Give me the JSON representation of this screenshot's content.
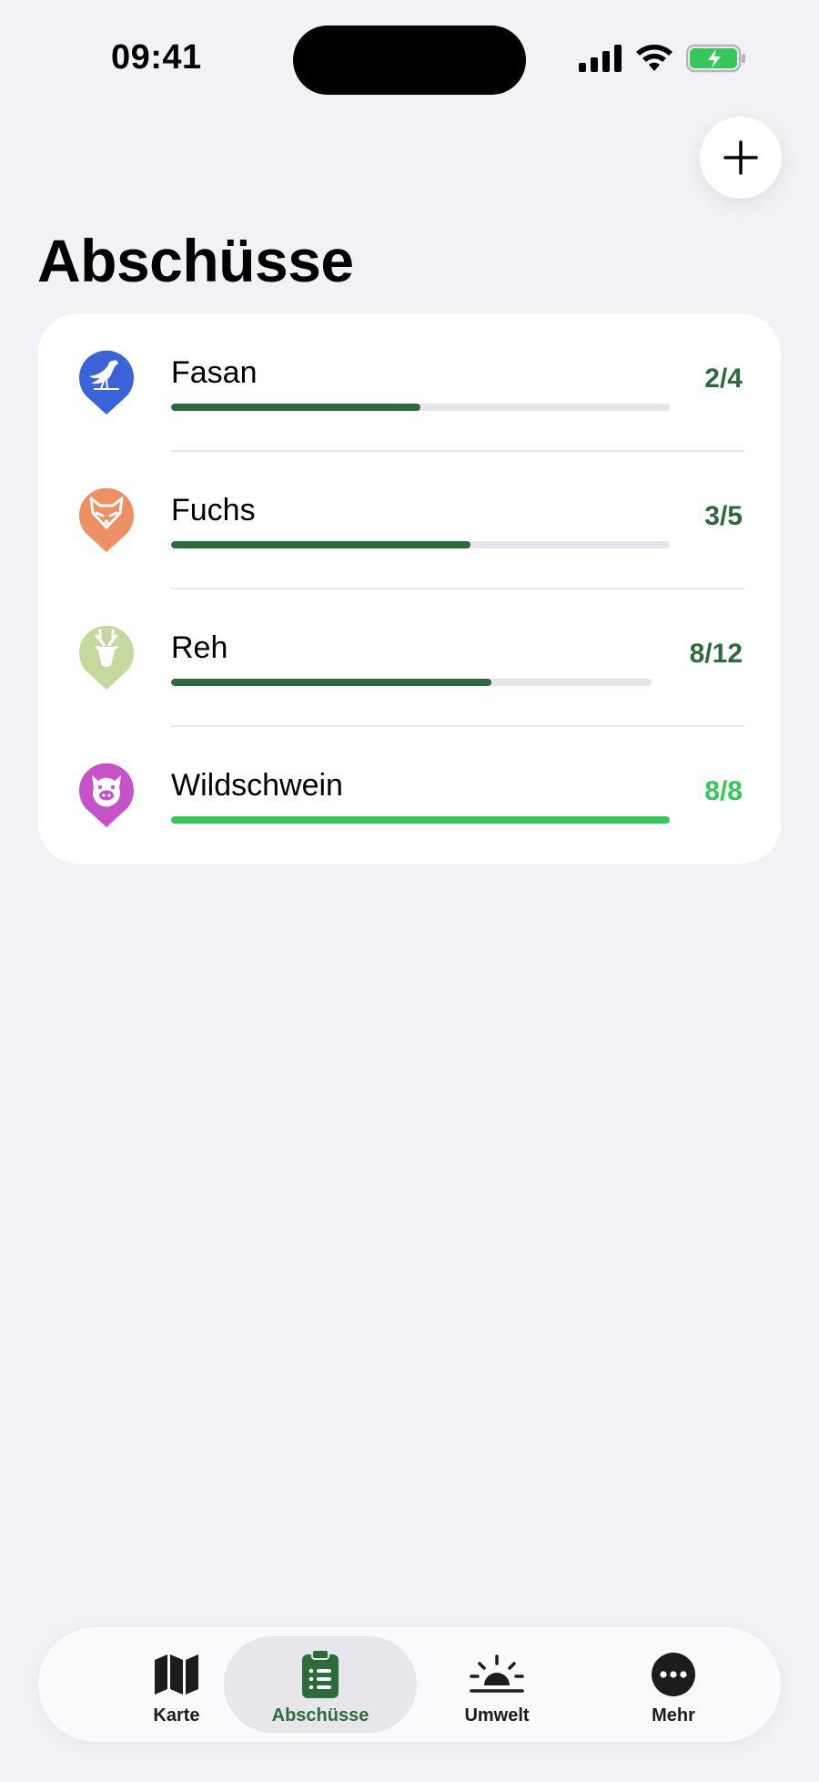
{
  "status_bar": {
    "time": "09:41"
  },
  "header": {
    "title": "Abschüsse"
  },
  "colors": {
    "progress_dark": "#2e6b3c",
    "progress_complete": "#34c759",
    "track": "#e5e5ea"
  },
  "species": [
    {
      "name": "Fasan",
      "count": "2/4",
      "progress": 0.5,
      "icon": "pheasant-icon",
      "pin_color": "#3a63d8",
      "complete": false
    },
    {
      "name": "Fuchs",
      "count": "3/5",
      "progress": 0.6,
      "icon": "fox-icon",
      "pin_color": "#ef8f64",
      "complete": false
    },
    {
      "name": "Reh",
      "count": "8/12",
      "progress": 0.667,
      "icon": "deer-icon",
      "pin_color": "#c4d99e",
      "complete": false
    },
    {
      "name": "Wildschwein",
      "count": "8/8",
      "progress": 1.0,
      "icon": "boar-icon",
      "pin_color": "#c552c9",
      "complete": true
    }
  ],
  "tabbar": {
    "items": [
      {
        "label": "Karte",
        "icon": "map-icon",
        "active": false
      },
      {
        "label": "Abschüsse",
        "icon": "clipboard-list-icon",
        "active": true
      },
      {
        "label": "Umwelt",
        "icon": "sunrise-icon",
        "active": false
      },
      {
        "label": "Mehr",
        "icon": "more-icon",
        "active": false
      }
    ]
  }
}
